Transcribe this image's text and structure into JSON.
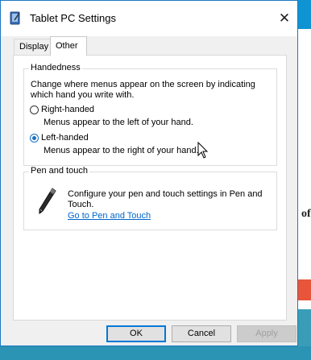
{
  "window": {
    "title": "Tablet PC Settings",
    "close_label": "✕"
  },
  "tabs": [
    {
      "label": "Display",
      "selected": false
    },
    {
      "label": "Other",
      "selected": true
    }
  ],
  "handedness": {
    "legend": "Handedness",
    "description": "Change where menus appear on the screen by indicating which hand you write with.",
    "options": [
      {
        "label": "Right-handed",
        "description": "Menus appear to the left of your hand.",
        "checked": false
      },
      {
        "label": "Left-handed",
        "description": "Menus appear to the right of your hand.",
        "checked": true
      }
    ]
  },
  "pen_touch": {
    "legend": "Pen and touch",
    "description": "Configure your pen and touch settings in Pen and Touch.",
    "link": "Go to Pen and Touch"
  },
  "buttons": {
    "ok": "OK",
    "cancel": "Cancel",
    "apply": "Apply"
  },
  "background": {
    "partial_text": "of"
  },
  "colors": {
    "accent": "#0078d7",
    "link": "#0066cc",
    "window_border": "#1b78c4"
  }
}
